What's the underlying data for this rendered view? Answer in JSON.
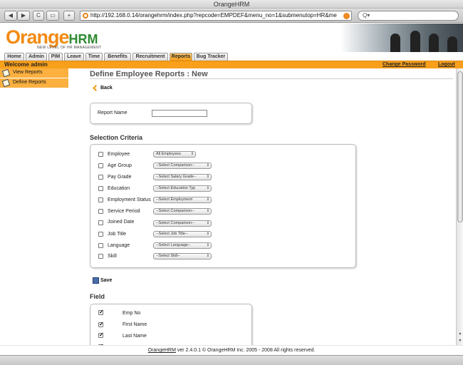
{
  "window": {
    "title": "OrangeHRM"
  },
  "browser": {
    "back_glyph": "◀",
    "forward_glyph": "▶",
    "reload_glyph": "C",
    "addtab_glyph": "+",
    "url": "http://192.168.0.14/orangehrm/index.php?repcode=EMPDEF&menu_no=1&submenutop=HR&me",
    "search_value": "Q▾"
  },
  "header": {
    "logo_orange": "Orange",
    "logo_hrm": "HRM",
    "tagline": "NEW LEVEL OF HR MANAGEMENT"
  },
  "nav": {
    "tabs": [
      {
        "label": "Home"
      },
      {
        "label": "Admin"
      },
      {
        "label": "PIM"
      },
      {
        "label": "Leave"
      },
      {
        "label": "Time"
      },
      {
        "label": "Benefits"
      },
      {
        "label": "Recruitment"
      },
      {
        "label": "Reports"
      },
      {
        "label": "Bug Tracker"
      }
    ],
    "active": "Reports"
  },
  "topbar": {
    "welcome": "Welcome admin",
    "change_password": "Change Password",
    "logout": "Logout"
  },
  "sidemenu": {
    "items": [
      {
        "label": "View Reports"
      },
      {
        "label": "Define Reports"
      }
    ]
  },
  "main": {
    "title": "Define Employee Reports : New",
    "back_label": "Back",
    "report_name_label": "Report Name",
    "report_name_value": "",
    "selection_title": "Selection Criteria",
    "criteria": [
      {
        "label": "Employee",
        "select": "All Employees"
      },
      {
        "label": "Age Group",
        "select": "--Select Comparison--"
      },
      {
        "label": "Pay Grade",
        "select": "--Select Salary Grade--"
      },
      {
        "label": "Education",
        "select": "--Select Education Typ"
      },
      {
        "label": "Employment Status",
        "select": "--Select Employment"
      },
      {
        "label": "Service Period",
        "select": "--Select Comparison--"
      },
      {
        "label": "Joined Date",
        "select": "--Select Comparison--"
      },
      {
        "label": "Job Title",
        "select": "--Select Job Title--"
      },
      {
        "label": "Language",
        "select": "--Select Language--"
      },
      {
        "label": "Skill",
        "select": "--Select Skill--"
      }
    ],
    "save_label": "Save",
    "field_title": "Field",
    "fields": [
      {
        "label": "Emp No",
        "checked": true
      },
      {
        "label": "First Name",
        "checked": true
      },
      {
        "label": "Last Name",
        "checked": true
      }
    ]
  },
  "footer": {
    "brand": "OrangeHRM",
    "text": " ver 2.4.0.1 © OrangeHRM Inc. 2005 - 2008 All rights reserved."
  },
  "colors": {
    "accent": "#f8a01c",
    "brand_green": "#2f8a31",
    "brand_orange": "#f28a12"
  }
}
